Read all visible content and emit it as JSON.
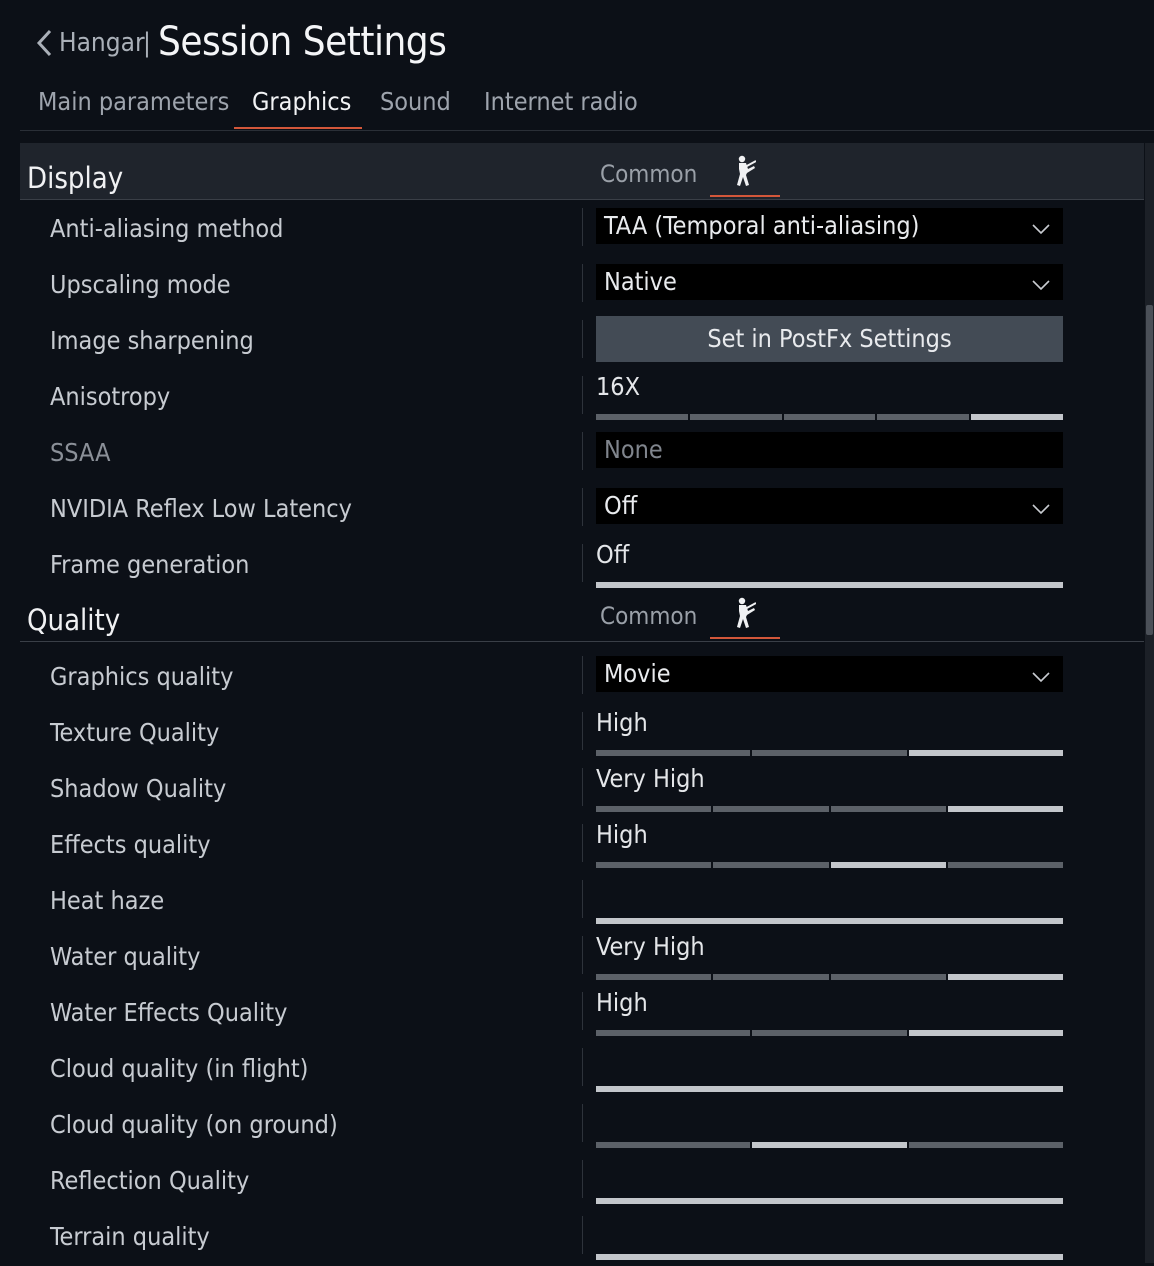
{
  "header": {
    "back_label": "Hangar",
    "separator": "|",
    "title": "Session Settings"
  },
  "tabs": [
    {
      "label": "Main parameters",
      "active": false
    },
    {
      "label": "Graphics",
      "active": true
    },
    {
      "label": "Sound",
      "active": false
    },
    {
      "label": "Internet radio",
      "active": false
    }
  ],
  "sections": {
    "display": {
      "title": "Display",
      "common_label": "Common",
      "rows": [
        {
          "label": "Anti-aliasing method",
          "control": "dropdown",
          "value": "TAA (Temporal anti-aliasing)"
        },
        {
          "label": "Upscaling mode",
          "control": "dropdown",
          "value": "Native"
        },
        {
          "label": "Image sharpening",
          "control": "button",
          "value": "Set in PostFx Settings"
        },
        {
          "label": "Anisotropy",
          "control": "slider",
          "value": "16X",
          "steps": 5,
          "level": 5
        },
        {
          "label": "SSAA",
          "control": "dropdown-disabled",
          "value": "None"
        },
        {
          "label": "NVIDIA Reflex Low Latency",
          "control": "dropdown",
          "value": "Off"
        },
        {
          "label": "Frame generation",
          "control": "slider",
          "value": "Off",
          "steps": 1,
          "level": 1
        }
      ]
    },
    "quality": {
      "title": "Quality",
      "common_label": "Common",
      "rows": [
        {
          "label": "Graphics quality",
          "control": "dropdown",
          "value": "Movie"
        },
        {
          "label": "Texture Quality",
          "control": "slider",
          "value": "High",
          "steps": 3,
          "level": 3
        },
        {
          "label": "Shadow Quality",
          "control": "slider",
          "value": "Very High",
          "steps": 4,
          "level": 4
        },
        {
          "label": "Effects quality",
          "control": "slider",
          "value": "High",
          "steps": 4,
          "level": 3
        },
        {
          "label": "Heat haze",
          "control": "slider",
          "value": "",
          "steps": 1,
          "level": 1
        },
        {
          "label": "Water quality",
          "control": "slider",
          "value": "Very High",
          "steps": 4,
          "level": 4
        },
        {
          "label": "Water Effects Quality",
          "control": "slider",
          "value": "High",
          "steps": 3,
          "level": 3
        },
        {
          "label": "Cloud quality (in flight)",
          "control": "slider",
          "value": "",
          "steps": 1,
          "level": 1
        },
        {
          "label": "Cloud quality (on ground)",
          "control": "slider",
          "value": "",
          "steps": 3,
          "level": 2
        },
        {
          "label": "Reflection Quality",
          "control": "slider",
          "value": "",
          "steps": 1,
          "level": 1
        },
        {
          "label": "Terrain quality",
          "control": "slider",
          "value": "",
          "steps": 1,
          "level": 1
        }
      ]
    }
  },
  "colors": {
    "background": "#0c1017",
    "accent": "#d3573a",
    "section_header_bg": "#1f242c",
    "button_bg": "#434b55"
  },
  "icons": {
    "back": "chevron-left-icon",
    "soldier": "soldier-icon",
    "dropdown": "chevron-down-icon"
  }
}
